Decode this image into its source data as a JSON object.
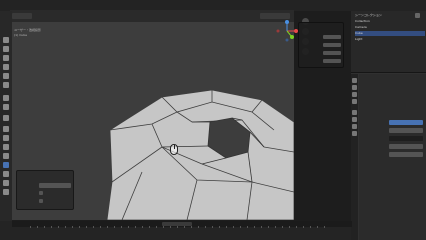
{
  "topbar": {
    "menu_hint": ""
  },
  "header": {
    "object_mode": "",
    "view_menu": "",
    "select_menu": "",
    "add_menu": "",
    "mesh_menu": ""
  },
  "viewport": {
    "info_line1": "ユーザー・透視投影",
    "info_line2": "(1) Cube",
    "mesh_color": "#c8c8c8",
    "edge_color": "#444444",
    "hole_color": "#3d3d3d"
  },
  "gizmo": {
    "x_color": "#e84a4a",
    "y_color": "#7ed321",
    "z_color": "#4a90e2"
  },
  "popup": {
    "title": "",
    "rows": [
      "",
      "",
      "",
      ""
    ]
  },
  "outliner": {
    "rows": [
      "シーンコレクション",
      "Collection",
      "Camera",
      "Cube",
      "Light"
    ],
    "accent": "#334d80"
  },
  "properties": {
    "section1": "",
    "section2": "",
    "accent": "#4772b3"
  },
  "operator_panel": {
    "title": "",
    "rows": [
      "",
      "",
      ""
    ]
  },
  "status": {
    "frame_start": "",
    "frame_end": ""
  }
}
